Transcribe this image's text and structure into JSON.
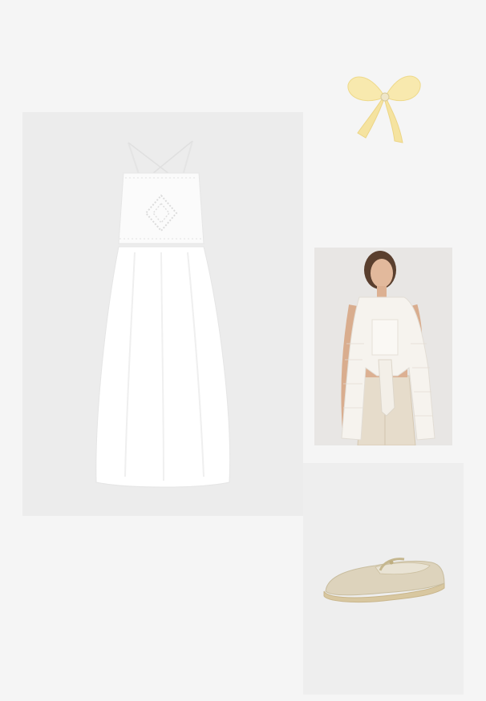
{
  "collage": {
    "items": [
      {
        "name": "white-midi-dress",
        "kind": "product-photo"
      },
      {
        "name": "yellow-hair-bow",
        "kind": "product-photo"
      },
      {
        "name": "crochet-tie-top-model",
        "kind": "product-photo"
      },
      {
        "name": "beige-mary-jane-espadrille",
        "kind": "product-photo"
      }
    ]
  },
  "colors": {
    "page_background": "#f5f5f5",
    "tile_background": "#ececec",
    "dress": "#ffffff",
    "bow": "#f7e7a8",
    "trousers": "#e6dccb",
    "shoe": "#d9cfb8"
  }
}
